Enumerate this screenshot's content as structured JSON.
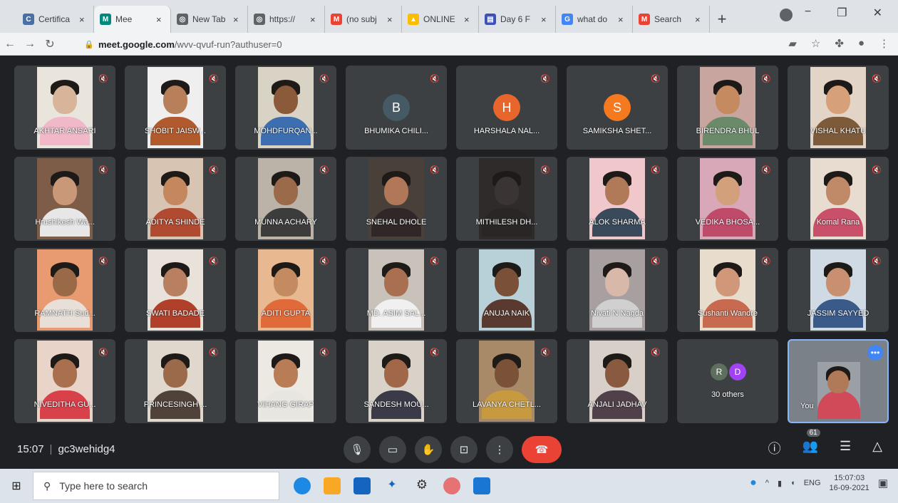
{
  "browser": {
    "tabs": [
      {
        "label": "Certifica",
        "fav_color": "#4a6fa5",
        "fav_glyph": "C"
      },
      {
        "label": "Mee",
        "fav_color": "#00897b",
        "fav_glyph": "M",
        "active": true
      },
      {
        "label": "New Tab",
        "fav_color": "#5f6368",
        "fav_glyph": "◎"
      },
      {
        "label": "https://",
        "fav_color": "#5f6368",
        "fav_glyph": "◎"
      },
      {
        "label": "(no subj",
        "fav_color": "#ea4335",
        "fav_glyph": "M"
      },
      {
        "label": "ONLINE",
        "fav_color": "#fbbc04",
        "fav_glyph": "▲"
      },
      {
        "label": "Day 6 F",
        "fav_color": "#3f51b5",
        "fav_glyph": "▤"
      },
      {
        "label": "what do",
        "fav_color": "#4285f4",
        "fav_glyph": "G"
      },
      {
        "label": "Search",
        "fav_color": "#ea4335",
        "fav_glyph": "M"
      }
    ],
    "new_tab": "+",
    "url_host": "meet.google.com",
    "url_path": "/wvv-qvuf-run?authuser=0"
  },
  "participants": [
    {
      "name": "AKHTAR ANSARI",
      "type": "video",
      "skin": "#d7b49a",
      "shirt": "#f0b8c8",
      "bg": "#e9e4dc"
    },
    {
      "name": "SHOBIT JAISW...",
      "type": "video",
      "skin": "#b8805a",
      "shirt": "#b05a2e",
      "bg": "#efefef"
    },
    {
      "name": "MOHDFURQAN...",
      "type": "video",
      "skin": "#8a5a3a",
      "shirt": "#3d6fb0",
      "bg": "#d9d3c5"
    },
    {
      "name": "BHUMIKA CHILI...",
      "type": "avatar",
      "initial": "B",
      "color": "#455a64"
    },
    {
      "name": "HARSHALA NAL...",
      "type": "avatar",
      "initial": "H",
      "color": "#e8652b"
    },
    {
      "name": "SAMIKSHA SHET...",
      "type": "avatar",
      "initial": "S",
      "color": "#f4791f"
    },
    {
      "name": "BIRENDRA BHUL",
      "type": "video",
      "skin": "#c58a60",
      "shirt": "#6a8a6a",
      "bg": "#c9a5a0"
    },
    {
      "name": "VISHAL KHATU",
      "type": "video",
      "skin": "#d6a07a",
      "shirt": "#7d5a3a",
      "bg": "#e2d5c8"
    },
    {
      "name": "Hrushikesh Wa...",
      "type": "video",
      "skin": "#c99878",
      "shirt": "#e7e7e7",
      "bg": "#7d5c48"
    },
    {
      "name": "ADITYA SHINDE",
      "type": "video",
      "skin": "#c5885e",
      "shirt": "#b04a30",
      "bg": "#d8c4b2"
    },
    {
      "name": "MUNNA ACHARY",
      "type": "video",
      "skin": "#9a6a4a",
      "shirt": "#3c3c3c",
      "bg": "#bcb3a8"
    },
    {
      "name": "SNEHAL DHOLE",
      "type": "video",
      "skin": "#b07858",
      "shirt": "#302828",
      "bg": "#4a403a"
    },
    {
      "name": "MITHILESH DH...",
      "type": "video",
      "skin": "#3a3434",
      "shirt": "#2a2626",
      "bg": "#2f2b2b"
    },
    {
      "name": "ALOK SHARMA",
      "type": "video",
      "skin": "#b07a58",
      "shirt": "#3a4a5a",
      "bg": "#f0c8cc"
    },
    {
      "name": "VEDIKA BHOSA...",
      "type": "video",
      "skin": "#d2a07a",
      "shirt": "#c04a6a",
      "bg": "#d8a8b8"
    },
    {
      "name": "Komal Rana",
      "type": "video",
      "skin": "#c08a68",
      "shirt": "#c8506a",
      "bg": "#e8dcd0"
    },
    {
      "name": "RAMNATH Sud...",
      "type": "video",
      "skin": "#9a6a48",
      "shirt": "#e8e0d8",
      "bg": "#e89a70"
    },
    {
      "name": "SWATI BADADE",
      "type": "video",
      "skin": "#b88060",
      "shirt": "#b0402a",
      "bg": "#e8e2da"
    },
    {
      "name": "ADITI GUPTA",
      "type": "video",
      "skin": "#c48a60",
      "shirt": "#e06a3a",
      "bg": "#e8b890"
    },
    {
      "name": "MD. ASIM SAL...",
      "type": "video",
      "skin": "#a87050",
      "shirt": "#f0f0f0",
      "bg": "#c8c2ba"
    },
    {
      "name": "ANUJA NAIK",
      "type": "video",
      "skin": "#7a5038",
      "shirt": "#5a3a30",
      "bg": "#b8d0d8"
    },
    {
      "name": "Nivati N Nagda",
      "type": "video",
      "skin": "#d8b8a8",
      "shirt": "#d0d0d0",
      "bg": "#a8a0a0"
    },
    {
      "name": "Sushanti Wandre",
      "type": "video",
      "skin": "#d09878",
      "shirt": "#c86a50",
      "bg": "#e8dccc"
    },
    {
      "name": "JASSIM SAYYED",
      "type": "video",
      "skin": "#c89070",
      "shirt": "#3a5a8a",
      "bg": "#d0dae4"
    },
    {
      "name": "NIVEDITHA GU...",
      "type": "video",
      "skin": "#a8704e",
      "shirt": "#d8404a",
      "bg": "#e8d4c8"
    },
    {
      "name": "PRINCESINGH ...",
      "type": "video",
      "skin": "#9a6a4a",
      "shirt": "#50423a",
      "bg": "#e0d8cc"
    },
    {
      "name": "VIHANG GIRAP",
      "type": "video",
      "skin": "#b87c56",
      "shirt": "#e8e6e0",
      "bg": "#ece8e2"
    },
    {
      "name": "SANDESH MOU...",
      "type": "video",
      "skin": "#a06848",
      "shirt": "#3a3a48",
      "bg": "#d8d2c8"
    },
    {
      "name": "LAVANYA CHETL...",
      "type": "video",
      "skin": "#7a5238",
      "shirt": "#c89a40",
      "bg": "#a88a68"
    },
    {
      "name": "ANJALI JADHAV",
      "type": "video",
      "skin": "#8a5a40",
      "shirt": "#50404a",
      "bg": "#d8d0c8"
    },
    {
      "name": "30 others",
      "type": "others",
      "badges": [
        {
          "letter": "R",
          "color": "#5f6f5f"
        },
        {
          "letter": "D",
          "color": "#a142f4"
        }
      ]
    },
    {
      "name": "You",
      "type": "self",
      "skin": "#b07a58",
      "shirt": "#d04a5a",
      "bg": "#9aa0a6"
    }
  ],
  "bottombar": {
    "time": "15:07",
    "meeting_code": "gc3wehidg4",
    "people_count": "61"
  },
  "taskbar": {
    "search_placeholder": "Type here to search",
    "language": "ENG",
    "clock_time": "15:07:03",
    "clock_date": "16-09-2021"
  },
  "colors": {
    "meet_bg": "#202124",
    "tile_bg": "#3c4043",
    "end_call": "#ea4335",
    "self_border": "#8ab4f8"
  }
}
